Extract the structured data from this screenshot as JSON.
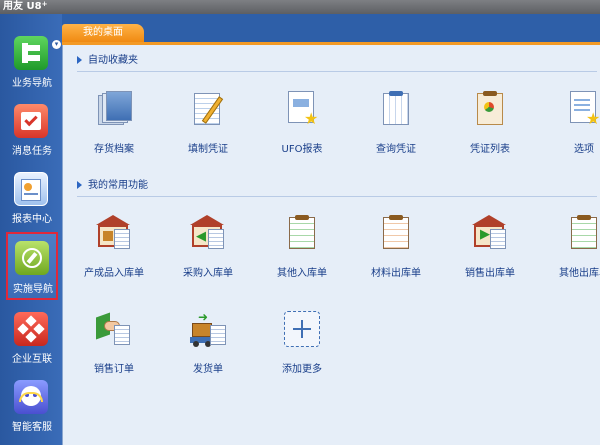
{
  "app": {
    "brand": "用友",
    "product": "U8",
    "product_sup": "+"
  },
  "sidebar": {
    "items": [
      {
        "label": "业务导航",
        "icon": "business-nav-icon"
      },
      {
        "label": "消息任务",
        "icon": "message-task-icon"
      },
      {
        "label": "报表中心",
        "icon": "report-center-icon"
      },
      {
        "label": "实施导航",
        "icon": "compass-icon",
        "selected": true
      },
      {
        "label": "企业互联",
        "icon": "enterprise-connect-icon"
      },
      {
        "label": "智能客服",
        "icon": "customer-service-icon"
      }
    ]
  },
  "tabs": [
    {
      "label": "我的桌面",
      "active": true
    }
  ],
  "sections": {
    "favorites": {
      "title": "自动收藏夹",
      "items": [
        {
          "label": "存货档案",
          "icon": "inventory-file-icon"
        },
        {
          "label": "填制凭证",
          "icon": "fill-voucher-icon"
        },
        {
          "label": "UFO报表",
          "icon": "ufo-report-icon"
        },
        {
          "label": "查询凭证",
          "icon": "query-voucher-icon"
        },
        {
          "label": "凭证列表",
          "icon": "voucher-list-icon"
        },
        {
          "label": "选项",
          "icon": "options-icon"
        }
      ]
    },
    "common": {
      "title": "我的常用功能",
      "items": [
        {
          "label": "产成品入库单",
          "icon": "finished-goods-inbound-icon"
        },
        {
          "label": "采购入库单",
          "icon": "purchase-inbound-icon"
        },
        {
          "label": "其他入库单",
          "icon": "other-inbound-icon"
        },
        {
          "label": "材料出库单",
          "icon": "material-outbound-icon"
        },
        {
          "label": "销售出库单",
          "icon": "sales-outbound-icon"
        },
        {
          "label": "其他出库单",
          "icon": "other-outbound-icon"
        },
        {
          "label": "销售订单",
          "icon": "sales-order-icon"
        },
        {
          "label": "发货单",
          "icon": "delivery-note-icon"
        },
        {
          "label": "添加更多",
          "icon": "add-more-icon"
        }
      ]
    }
  },
  "colors": {
    "accent": "#f08a12",
    "sidebar": "#2e5fa8",
    "content_bg": "#e6eef8",
    "label_text": "#1a3f8a",
    "selected_border": "#e0283a"
  }
}
